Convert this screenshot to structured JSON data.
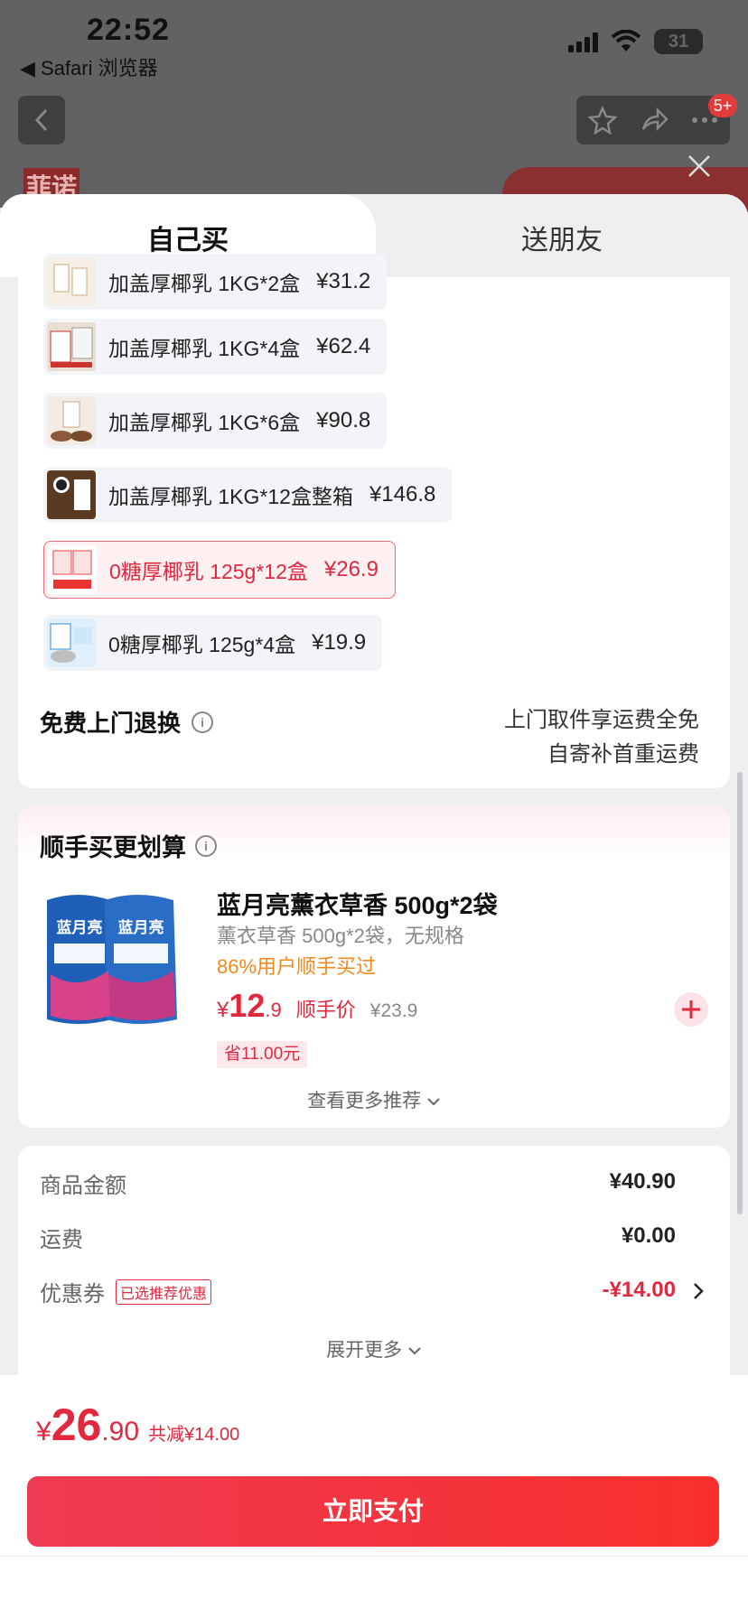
{
  "status": {
    "time": "22:52",
    "back_app": "◀ Safari 浏览器",
    "battery": "31"
  },
  "nav": {
    "badge": "5+",
    "bg_brand": "菲诺"
  },
  "tabs": [
    "自己买",
    "送朋友"
  ],
  "options": [
    {
      "label": "加盖厚椰乳 1KG*2盒",
      "price": "¥31.2",
      "selected": false
    },
    {
      "label": "加盖厚椰乳 1KG*4盒",
      "price": "¥62.4",
      "selected": false
    },
    {
      "label": "加盖厚椰乳 1KG*6盒",
      "price": "¥90.8",
      "selected": false
    },
    {
      "label": "加盖厚椰乳 1KG*12盒整箱",
      "price": "¥146.8",
      "selected": false
    },
    {
      "label": "0糖厚椰乳 125g*12盒",
      "price": "¥26.9",
      "selected": true
    },
    {
      "label": "0糖厚椰乳 125g*4盒",
      "price": "¥19.9",
      "selected": false
    }
  ],
  "returns": {
    "title": "免费上门退换",
    "line1": "上门取件享运费全免",
    "line2": "自寄补首重运费"
  },
  "addon": {
    "title": "顺手买更划算",
    "product_name": "蓝月亮薰衣草香 500g*2袋",
    "spec": "薰衣草香 500g*2袋，无规格",
    "buyers": "86%用户顺手买过",
    "price_symbol": "¥",
    "price_int": "12",
    "price_dec": ".9",
    "price_label": "顺手价",
    "orig_price": "¥23.9",
    "save": "省11.00元",
    "brand_text": "蓝月亮",
    "more": "查看更多推荐"
  },
  "summary": {
    "goods_label": "商品金额",
    "goods_value": "¥40.90",
    "shipping_label": "运费",
    "shipping_value": "¥0.00",
    "coupon_label": "优惠券",
    "coupon_tag": "已选推荐优惠",
    "coupon_value": "-¥14.00",
    "expand": "展开更多"
  },
  "footer": {
    "symbol": "¥",
    "total_int": "26",
    "total_dec": ".90",
    "reduce": "共减¥14.00",
    "pay": "立即支付"
  },
  "colors": {
    "accent": "#e0283e",
    "orange": "#f08a1c"
  }
}
